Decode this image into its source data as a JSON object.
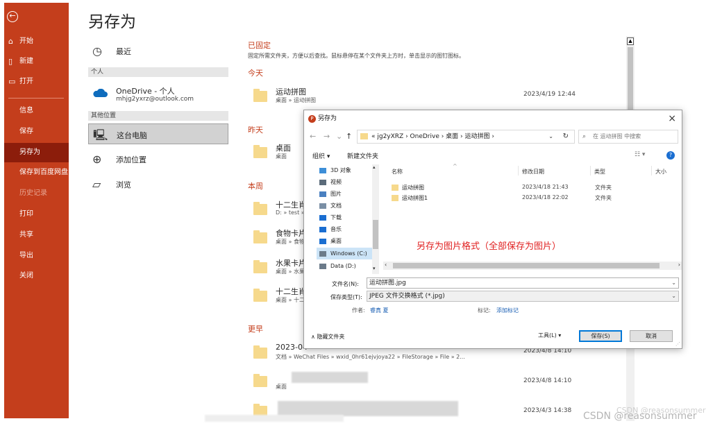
{
  "sidebar": {
    "back_icon": "arrow-left-icon",
    "items": [
      {
        "label": "开始",
        "icon": "home-icon"
      },
      {
        "label": "新建",
        "icon": "new-document-icon"
      },
      {
        "label": "打开",
        "icon": "folder-open-icon"
      },
      {
        "label": "信息"
      },
      {
        "label": "保存"
      },
      {
        "label": "另存为"
      },
      {
        "label": "保存到百度网盘"
      },
      {
        "label": "历史记录"
      },
      {
        "label": "打印"
      },
      {
        "label": "共享"
      },
      {
        "label": "导出"
      },
      {
        "label": "关闭"
      }
    ],
    "active_index": 5,
    "accent_color": "#c43e1c",
    "active_color": "#8c1d0b"
  },
  "page": {
    "title": "另存为"
  },
  "locations": {
    "recent": "最近",
    "personal_section": "个人",
    "onedrive_name": "OneDrive - 个人",
    "onedrive_account": "mhjg2yxrz@outlook.com",
    "other_section": "其他位置",
    "this_pc": "这台电脑",
    "add_place": "添加位置",
    "browse": "浏览"
  },
  "files": {
    "pinned_title": "已固定",
    "pinned_desc": "固定所需文件夹，方便以后查找。鼠标悬停在某个文件夹上方时，单击显示的图钉图标。",
    "groups": {
      "today": "今天",
      "yesterday": "昨天",
      "this_week": "本周",
      "earlier": "更早"
    },
    "today": [
      {
        "name": "运动拼图",
        "path": "桌面 » 运动拼图",
        "date": "2023/4/19 12:44"
      }
    ],
    "yesterday": [
      {
        "name": "桌面",
        "path": "桌面"
      }
    ],
    "this_week": [
      {
        "name": "十二生肖",
        "path": "D: » test »"
      },
      {
        "name": "食物卡片",
        "path": "桌面 » 食物"
      },
      {
        "name": "水果卡片",
        "path": "桌面 » 水果"
      },
      {
        "name": "十二生肖",
        "path": "桌面 » 十二"
      }
    ],
    "earlier": [
      {
        "name": "2023-04",
        "path": "文档 » WeChat Files » wxid_0hr61ejvjoya22 » FileStorage » File » 2...",
        "date": "2023/4/8 14:10"
      },
      {
        "name": "",
        "path": "桌面",
        "date": "2023/4/8 14:10"
      },
      {
        "name": "",
        "path": "",
        "date": "2023/4/3 14:38"
      }
    ]
  },
  "dialog": {
    "title": "另存为",
    "close": "×",
    "address_path": "« jg2yXRZ › OneDrive › 桌面 › 运动拼图 ›",
    "search_placeholder": "在 运动拼图 中搜索",
    "organize": "组织 ▾",
    "new_folder": "新建文件夹",
    "view_icon": "view-options-icon",
    "help": "?",
    "tree": [
      {
        "label": "3D 对象",
        "color": "#3d8fd8"
      },
      {
        "label": "视频",
        "color": "#5b6b7a"
      },
      {
        "label": "图片",
        "color": "#4a80c0"
      },
      {
        "label": "文档",
        "color": "#7a8fa5"
      },
      {
        "label": "下载",
        "color": "#1a6ed1"
      },
      {
        "label": "音乐",
        "color": "#1a6ed1"
      },
      {
        "label": "桌面",
        "color": "#1a6ed1"
      },
      {
        "label": "Windows (C:)",
        "color": "#6b7b8a"
      },
      {
        "label": "Data (D:)",
        "color": "#6b7b8a"
      }
    ],
    "tree_selected_index": 7,
    "columns": {
      "name": "名称",
      "date": "修改日期",
      "type": "类型",
      "size": "大小"
    },
    "rows": [
      {
        "name": "运动拼图",
        "date": "2023/4/18 21:43",
        "type": "文件夹"
      },
      {
        "name": "运动拼图1",
        "date": "2023/4/18 22:02",
        "type": "文件夹"
      }
    ],
    "annotation": "另存为图片格式（全部保存为图片）",
    "filename_label": "文件名(N):",
    "filename_value": "运动拼图.jpg",
    "filetype_label": "保存类型(T):",
    "filetype_value": "JPEG 文件交换格式 (*.jpg)",
    "author_label": "作者:",
    "author_value": "睿真 夏",
    "tags_label": "标记:",
    "tags_value": "添加标记",
    "hide_folders": "隐藏文件夹",
    "tools": "工具(L)",
    "save": "保存(S)",
    "cancel": "取消"
  },
  "watermark": {
    "small": "CSDN @reasonsummer",
    "large": "CSDN @reasonsummer"
  }
}
